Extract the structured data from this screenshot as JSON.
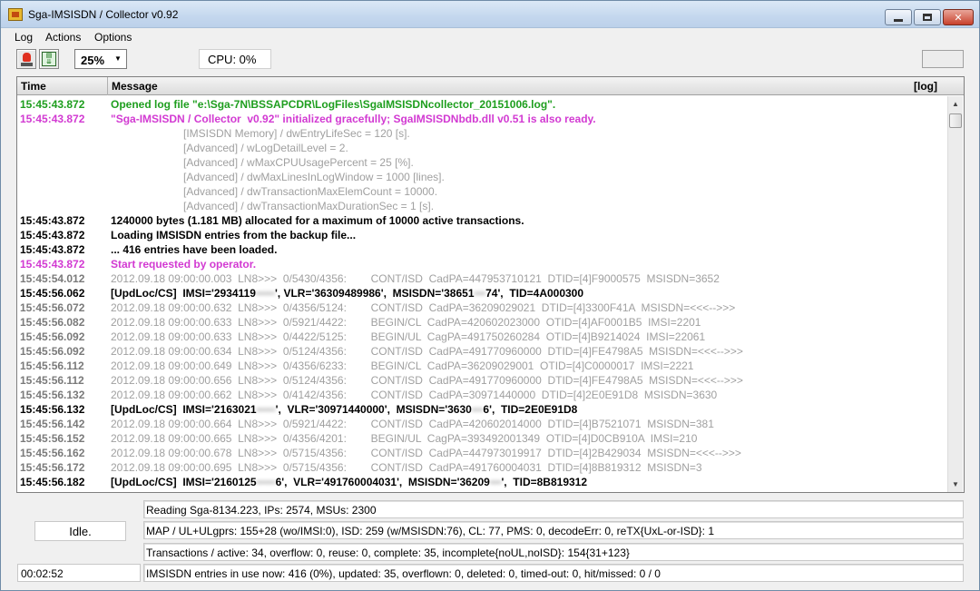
{
  "window": {
    "title": "Sga-IMSISDN / Collector  v0.92"
  },
  "menu": [
    "Log",
    "Actions",
    "Options"
  ],
  "toolbar": {
    "zoom": "25%",
    "cpu_label": "CPU:  0%"
  },
  "log": {
    "columns": {
      "time": "Time",
      "message": "Message",
      "log": "[log]"
    },
    "colors": {
      "green": "#1e9e1e",
      "magenta": "#d23ad2",
      "black": "#000000",
      "gray": "#a0a0a0",
      "dark_gray": "#7a7a7a"
    },
    "lines": [
      {
        "time": "15:45:43.872",
        "message": "Opened log file \"e:\\Sga-7N\\BSSAPCDR\\LogFiles\\SgaIMSISDNcollector_20151006.log\".",
        "color": "green"
      },
      {
        "time": "15:45:43.872",
        "message": "\"Sga-IMSISDN / Collector  v0.92\" initialized gracefully; SgaIMSISDNbdb.dll v0.51 is also ready.",
        "color": "magenta"
      },
      {
        "time": "",
        "message": "[IMSISDN Memory] / dwEntryLifeSec = 120 [s].",
        "color": "gray",
        "indent": true
      },
      {
        "time": "",
        "message": "[Advanced] / wLogDetailLevel = 2.",
        "color": "gray",
        "indent": true
      },
      {
        "time": "",
        "message": "[Advanced] / wMaxCPUUsagePercent = 25 [%].",
        "color": "gray",
        "indent": true
      },
      {
        "time": "",
        "message": "[Advanced] / dwMaxLinesInLogWindow = 1000 [lines].",
        "color": "gray",
        "indent": true
      },
      {
        "time": "",
        "message": "[Advanced] / dwTransactionMaxElemCount = 10000.",
        "color": "gray",
        "indent": true
      },
      {
        "time": "",
        "message": "[Advanced] / dwTransactionMaxDurationSec = 1 [s].",
        "color": "gray",
        "indent": true
      },
      {
        "time": "15:45:43.872",
        "message": "1240000 bytes (1.181 MB) allocated for a maximum of 10000 active transactions.",
        "color": "black"
      },
      {
        "time": "15:45:43.872",
        "message": "Loading IMSISDN entries from the backup file...",
        "color": "black"
      },
      {
        "time": "15:45:43.872",
        "message": "... 416 entries have been loaded.",
        "color": "black"
      },
      {
        "time": "15:45:43.872",
        "message": "Start requested by operator.",
        "color": "magenta"
      },
      {
        "time": "15:45:54.012",
        "message": "2012.09.18 09:00:00.003  LN8>>>  0/5430/4356:        CONT/ISD  CadPA=447953710121  DTID=[4]F9000575  MSISDN=3652",
        "color": "gray"
      },
      {
        "time": "15:45:56.062",
        "message": "[UpdLoc/CS]  IMSI='2934119",
        "message_tail": "', VLR='36309489986',  MSISDN='38651",
        "message_end": "74',  TID=4A000300",
        "color": "black"
      },
      {
        "time": "15:45:56.072",
        "message": "2012.09.18 09:00:00.632  LN8>>>  0/4356/5124:        CONT/ISD  CadPA=36209029021  DTID=[4]3300F41A  MSISDN=<<<-->>>",
        "color": "gray"
      },
      {
        "time": "15:45:56.082",
        "message": "2012.09.18 09:00:00.633  LN8>>>  0/5921/4422:        BEGIN/CL  CadPA=420602023000  OTID=[4]AF0001B5  IMSI=2201",
        "color": "gray"
      },
      {
        "time": "15:45:56.092",
        "message": "2012.09.18 09:00:00.633  LN8>>>  0/4422/5125:        BEGIN/UL  CagPA=491750260284  OTID=[4]B9214024  IMSI=22061",
        "color": "gray"
      },
      {
        "time": "15:45:56.092",
        "message": "2012.09.18 09:00:00.634  LN8>>>  0/5124/4356:        CONT/ISD  CadPA=491770960000  DTID=[4]FE4798A5  MSISDN=<<<-->>>",
        "color": "gray"
      },
      {
        "time": "15:45:56.112",
        "message": "2012.09.18 09:00:00.649  LN8>>>  0/4356/6233:        BEGIN/CL  CadPA=36209029001  OTID=[4]C0000017  IMSI=2221",
        "color": "gray"
      },
      {
        "time": "15:45:56.112",
        "message": "2012.09.18 09:00:00.656  LN8>>>  0/5124/4356:        CONT/ISD  CadPA=491770960000  DTID=[4]FE4798A5  MSISDN=<<<-->>>",
        "color": "gray"
      },
      {
        "time": "15:45:56.132",
        "message": "2012.09.18 09:00:00.662  LN8>>>  0/4142/4356:        CONT/ISD  CadPA=30971440000  DTID=[4]2E0E91D8  MSISDN=3630",
        "color": "gray"
      },
      {
        "time": "15:45:56.132",
        "message": "[UpdLoc/CS]  IMSI='2163021",
        "message_tail": "',  VLR='30971440000',  MSISDN='3630",
        "message_end": "6',  TID=2E0E91D8",
        "color": "black"
      },
      {
        "time": "15:45:56.142",
        "message": "2012.09.18 09:00:00.664  LN8>>>  0/5921/4422:        CONT/ISD  CadPA=420602014000  DTID=[4]B7521071  MSISDN=381",
        "color": "gray"
      },
      {
        "time": "15:45:56.152",
        "message": "2012.09.18 09:00:00.665  LN8>>>  0/4356/4201:        BEGIN/UL  CagPA=393492001349  OTID=[4]D0CB910A  IMSI=210",
        "color": "gray"
      },
      {
        "time": "15:45:56.162",
        "message": "2012.09.18 09:00:00.678  LN8>>>  0/5715/4356:        CONT/ISD  CadPA=447973019917  DTID=[4]2B429034  MSISDN=<<<-->>>",
        "color": "gray"
      },
      {
        "time": "15:45:56.172",
        "message": "2012.09.18 09:00:00.695  LN8>>>  0/5715/4356:        CONT/ISD  CadPA=491760004031  DTID=[4]8B819312  MSISDN=3",
        "color": "gray"
      },
      {
        "time": "15:45:56.182",
        "message": "[UpdLoc/CS]  IMSI='2160125",
        "message_tail": "6',  VLR='491760004031',  MSISDN='36209",
        "message_end": "',  TID=8B819312",
        "color": "black"
      }
    ]
  },
  "status": {
    "state": "Idle.",
    "elapsed": "00:02:52",
    "rows": [
      "Reading Sga-8134.223, IPs: 2574, MSUs: 2300",
      "MAP / UL+ULgprs: 155+28 (wo/IMSI:0), ISD: 259 (w/MSISDN:76), CL: 77, PMS: 0, decodeErr: 0, reTX{UxL-or-ISD}: 1",
      "Transactions / active: 34, overflow: 0, reuse: 0, complete: 35, incomplete{noUL,noISD}: 154{31+123}",
      "IMSISDN entries in use now: 416 (0%), updated: 35, overflown: 0, deleted: 0, timed-out: 0, hit/missed: 0 / 0"
    ]
  }
}
